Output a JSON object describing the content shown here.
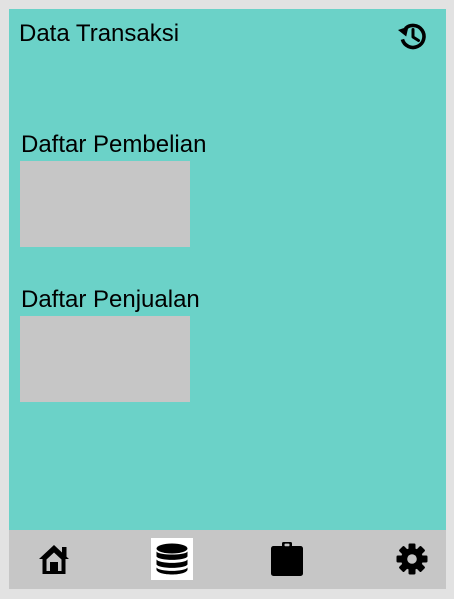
{
  "app": {
    "title": "Data Transaksi",
    "history_icon": "history-icon"
  },
  "sections": [
    {
      "label": "Daftar Pembelian"
    },
    {
      "label": "Daftar Penjualan"
    }
  ],
  "colors": {
    "background": "#6bd2c8",
    "placeholder": "#c6c6c6",
    "nav_bar": "#c6c6c6",
    "nav_active": "#ffffff"
  },
  "nav": {
    "items": [
      {
        "icon": "home-icon",
        "active": false
      },
      {
        "icon": "database-icon",
        "active": true
      },
      {
        "icon": "clipboard-icon",
        "active": false
      },
      {
        "icon": "gear-icon",
        "active": false
      }
    ]
  }
}
